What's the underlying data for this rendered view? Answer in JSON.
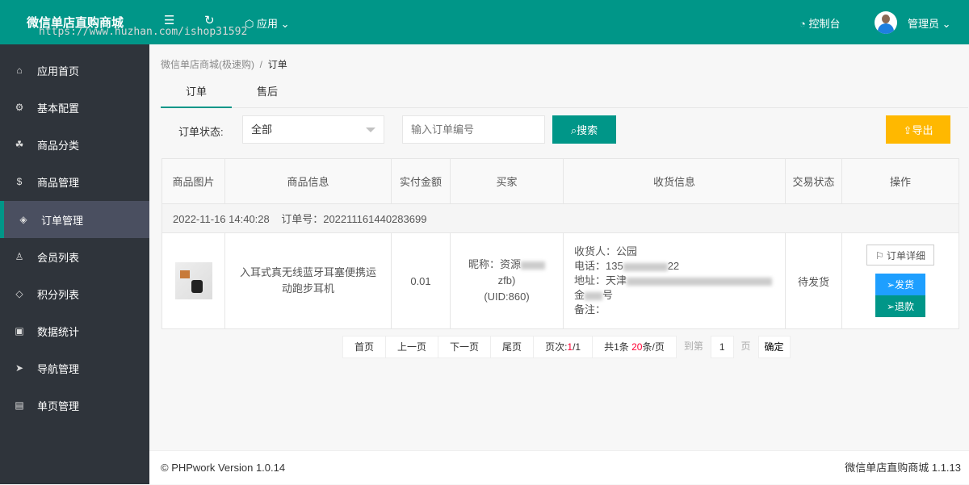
{
  "header": {
    "logo": "微信单店直购商城",
    "watermark": "https://www.huzhan.com/ishop31592",
    "apps": "应用",
    "console": "控制台",
    "user": "管理员"
  },
  "sidebar": {
    "items": [
      {
        "label": "应用首页",
        "icon": "home-icon"
      },
      {
        "label": "基本配置",
        "icon": "gear-icon"
      },
      {
        "label": "商品分类",
        "icon": "category-icon"
      },
      {
        "label": "商品管理",
        "icon": "shop-bag-icon"
      },
      {
        "label": "订单管理",
        "icon": "layers-icon",
        "active": true
      },
      {
        "label": "会员列表",
        "icon": "user-icon"
      },
      {
        "label": "积分列表",
        "icon": "diamond-icon"
      },
      {
        "label": "数据统计",
        "icon": "chart-icon"
      },
      {
        "label": "导航管理",
        "icon": "navigation-icon"
      },
      {
        "label": "单页管理",
        "icon": "file-icon"
      }
    ]
  },
  "breadcrumb": {
    "parent": "微信单店商城(极速购)",
    "sep": "/",
    "current": "订单"
  },
  "tabs": [
    "订单",
    "售后"
  ],
  "filter": {
    "status_label": "订单状态:",
    "status_value": "全部",
    "order_placeholder": "输入订单编号",
    "search": "搜索",
    "export": "导出"
  },
  "table": {
    "headers": [
      "商品图片",
      "商品信息",
      "实付金额",
      "买家",
      "收货信息",
      "交易状态",
      "操作"
    ],
    "orders": [
      {
        "date": "2022-11-16 14:40:28",
        "order_no_label": "订单号：",
        "order_no": "202211161440283699",
        "product": "入耳式真无线蓝牙耳塞便携运动跑步耳机",
        "amount": "0.01",
        "buyer_nick": "昵称：资源",
        "buyer_suffix": "zfb)",
        "buyer_uid": "(UID:860)",
        "receiver": "收货人：公园",
        "phone": "电话：135",
        "phone_end": "22",
        "address": "地址：天津",
        "address2": "金",
        "address2_end": "号",
        "note": "备注：",
        "status": "待发货",
        "actions": {
          "detail": "订单详细",
          "ship": "发货",
          "refund": "退款"
        }
      }
    ]
  },
  "pagination": {
    "first": "首页",
    "prev": "上一页",
    "next": "下一页",
    "last": "尾页",
    "page_label": "页次:",
    "page_current": "1",
    "page_total": "/1",
    "total_prefix": "共1条 ",
    "per_page": "20",
    "per_page_suffix": "条/页",
    "goto": "到第",
    "goto_value": "1",
    "page_unit": "页",
    "confirm": "确定"
  },
  "footer": {
    "left": "© PHPwork Version 1.0.14",
    "right": "微信单店直购商城 1.1.13"
  },
  "colors": {
    "primary": "#009688",
    "sidebar": "#2f343b",
    "export": "#ffb800",
    "ship": "#1e9fff"
  }
}
